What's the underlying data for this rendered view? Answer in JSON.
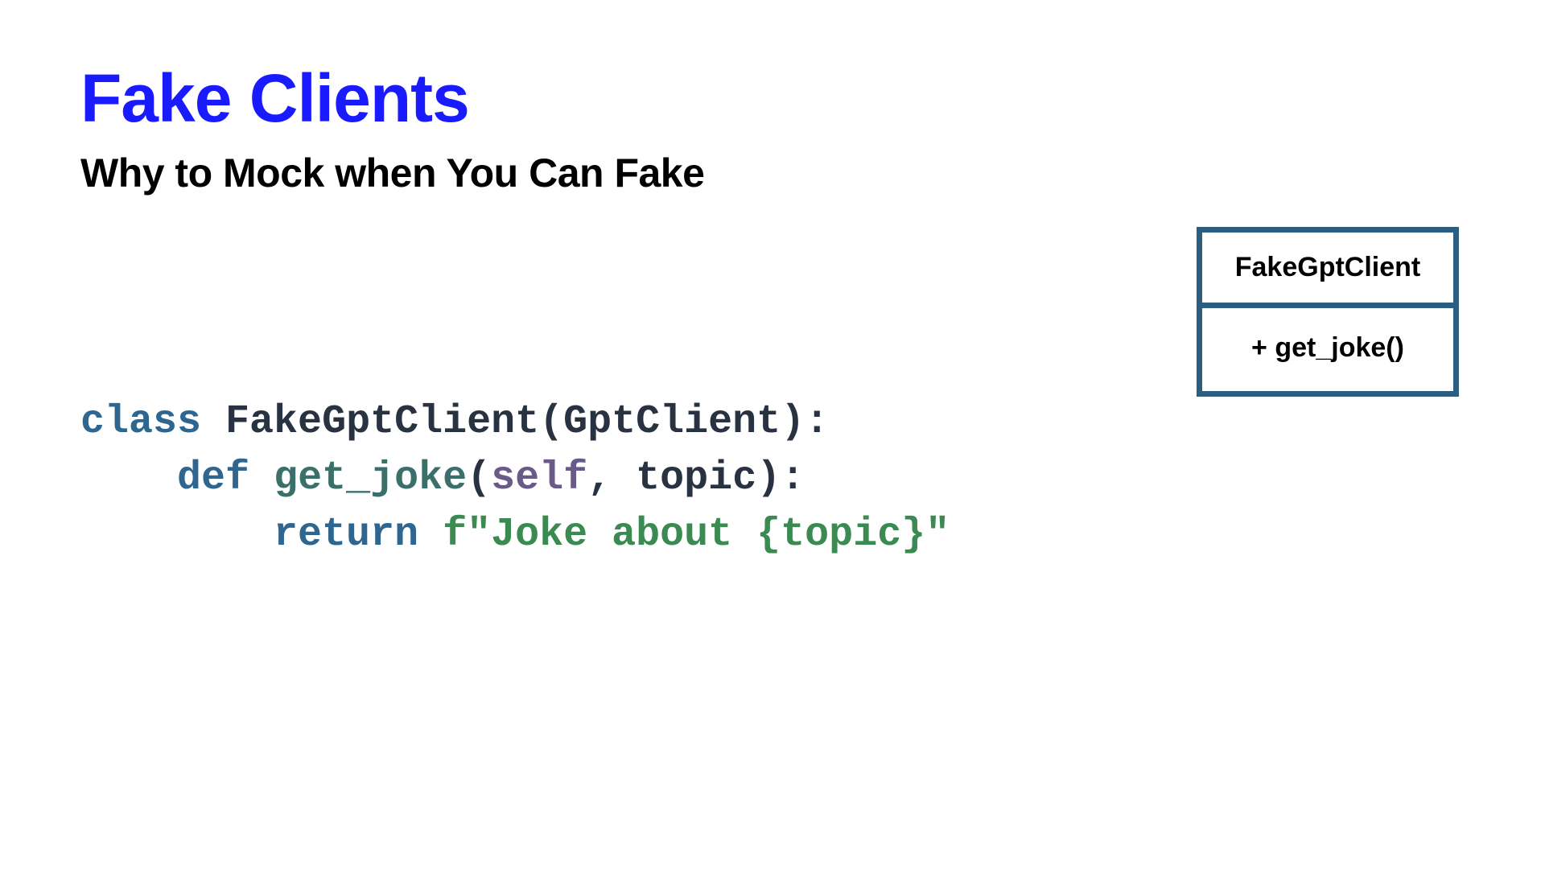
{
  "title": "Fake Clients",
  "subtitle": "Why to Mock when You Can Fake",
  "uml": {
    "class_name": "FakeGptClient",
    "method": "+ get_joke()"
  },
  "code": {
    "kw_class": "class",
    "class_name": "FakeGptClient",
    "parent": "GptClient",
    "kw_def": "def",
    "fn_name": "get_joke",
    "self": "self",
    "param": "topic",
    "kw_return": "return",
    "fstr_prefix": "f",
    "string": "\"Joke about {topic}\""
  }
}
